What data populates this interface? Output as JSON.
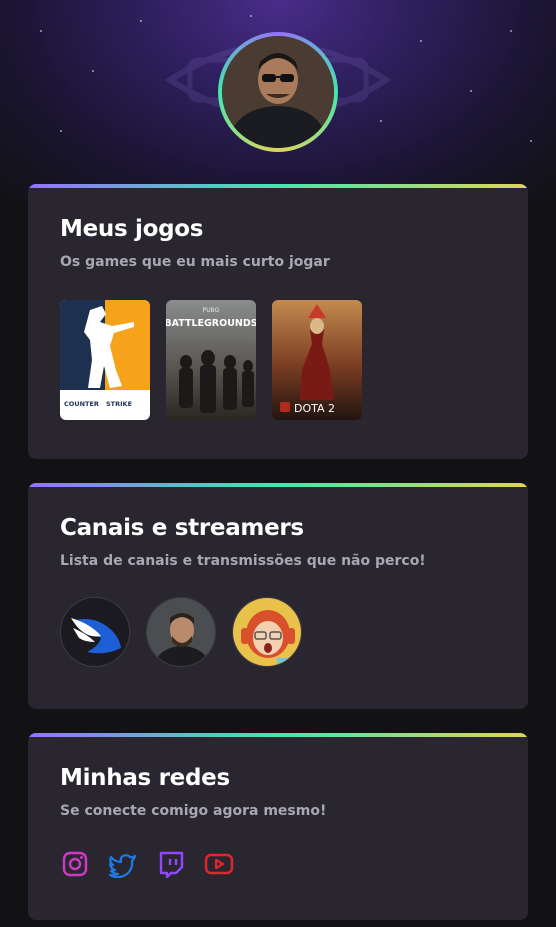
{
  "games_section": {
    "title": "Meus jogos",
    "subtitle": "Os games que eu mais curto jogar",
    "games": [
      {
        "label_top": "COUNTER",
        "label_bottom": "STRIKE"
      },
      {
        "label_top": "PUBG",
        "label_bottom": "BATTLEGROUNDS"
      },
      {
        "label": "DOTA 2"
      }
    ]
  },
  "channels_section": {
    "title": "Canais e streamers",
    "subtitle": "Lista de canais e transmissões que não perco!",
    "channels": [
      {
        "icon": "winged-logo-icon"
      },
      {
        "icon": "streamer-avatar-icon"
      },
      {
        "icon": "redhead-streamer-avatar-icon"
      }
    ]
  },
  "socials_section": {
    "title": "Minhas redes",
    "subtitle": "Se conecte comigo agora mesmo!",
    "links": [
      {
        "icon": "instagram-icon",
        "color": "#ce39c4"
      },
      {
        "icon": "twitter-icon",
        "color": "#1d7ae8"
      },
      {
        "icon": "twitch-icon",
        "color": "#9146ff"
      },
      {
        "icon": "youtube-icon",
        "color": "#e2262b"
      }
    ]
  },
  "colors": {
    "background": "#121214",
    "card": "#29262f",
    "gradient": [
      "#9572fc",
      "#43e7ad",
      "#e2d45c"
    ],
    "title": "#ffffff",
    "subtitle": "#a8a8b3"
  }
}
